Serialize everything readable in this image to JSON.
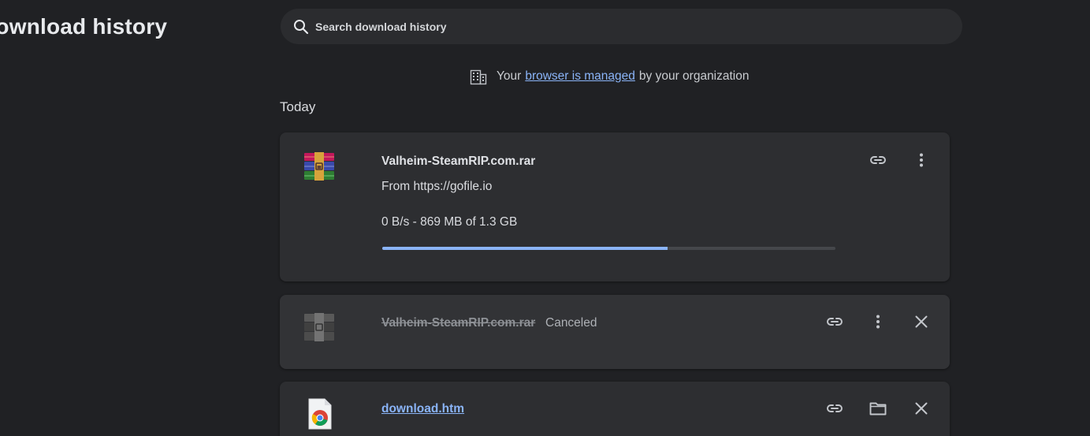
{
  "header": {
    "title": "Download history"
  },
  "search": {
    "placeholder": "Search download history"
  },
  "managed_notice": {
    "prefix": "Your",
    "link_text": "browser is managed",
    "suffix": "by your organization"
  },
  "section": {
    "label": "Today"
  },
  "downloads": [
    {
      "file_name": "Valheim-SteamRIP.com.rar",
      "source": "From https://gofile.io",
      "progress_text": "0 B/s - 869 MB of 1.3 GB",
      "progress_fraction": 0.63,
      "icon": "winrar-archive-icon",
      "actions": [
        "copy-link-icon",
        "more-vert-icon"
      ]
    },
    {
      "file_name": "Valheim-SteamRIP.com.rar",
      "status": "Canceled",
      "icon": "winrar-archive-icon",
      "actions": [
        "copy-link-icon",
        "more-vert-icon",
        "close-icon"
      ]
    },
    {
      "file_name": "download.htm",
      "icon": "chrome-html-file-icon",
      "actions": [
        "copy-link-icon",
        "folder-icon",
        "close-icon"
      ]
    }
  ],
  "colors": {
    "background": "#202124",
    "card": "#2d2e31",
    "accent": "#8ab4f8",
    "progress_track": "#45474b"
  }
}
